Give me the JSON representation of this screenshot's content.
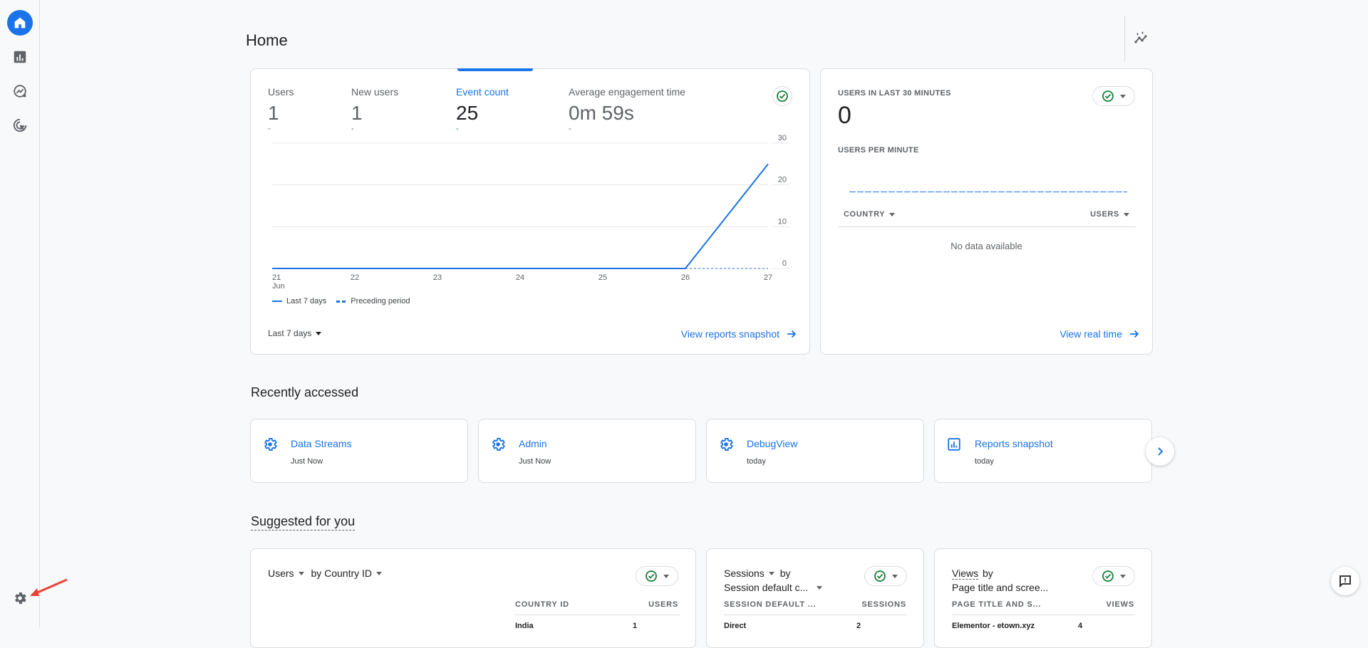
{
  "sidebar": {
    "items": [
      {
        "name": "home",
        "icon": "home-icon",
        "active": true
      },
      {
        "name": "reports",
        "icon": "bar-chart-icon",
        "active": false
      },
      {
        "name": "explore",
        "icon": "explore-icon",
        "active": false
      },
      {
        "name": "advertising",
        "icon": "target-cursor-icon",
        "active": false
      }
    ],
    "settings_icon": "gear-icon"
  },
  "header": {
    "title": "Home",
    "insights_icon": "insights-sparkle-icon"
  },
  "overview_card": {
    "metrics": [
      {
        "label": "Users",
        "value": "1",
        "change": "-",
        "active": false
      },
      {
        "label": "New users",
        "value": "1",
        "change": "-",
        "active": false
      },
      {
        "label": "Event count",
        "value": "25",
        "change": "-",
        "active": true
      },
      {
        "label": "Average engagement time",
        "value": "0m 59s",
        "change": "-",
        "active": false
      }
    ],
    "date_range": "Last 7 days",
    "link": "View reports snapshot"
  },
  "chart_data": {
    "type": "line",
    "title": "Event count",
    "x": [
      "21",
      "22",
      "23",
      "24",
      "25",
      "26",
      "27"
    ],
    "x_sublabel": "Jun",
    "series": [
      {
        "name": "Last 7 days",
        "values": [
          0,
          0,
          0,
          0,
          0,
          0,
          25
        ],
        "style": "solid"
      },
      {
        "name": "Preceding period",
        "values": [
          null,
          null,
          null,
          null,
          null,
          0,
          0
        ],
        "style": "dashed"
      }
    ],
    "yticks": [
      0,
      10,
      20,
      30
    ],
    "ylim": [
      0,
      30
    ],
    "y_axis_side": "right",
    "grid": true,
    "legend": "bottom-left",
    "colors": {
      "primary": "#1a73e8"
    }
  },
  "realtime_card": {
    "title": "USERS IN LAST 30 MINUTES",
    "value": "0",
    "subtitle": "USERS PER MINUTE",
    "columns": [
      "COUNTRY",
      "USERS"
    ],
    "empty_text": "No data available",
    "link": "View real time"
  },
  "recently_accessed": {
    "title": "Recently accessed",
    "items": [
      {
        "title": "Data Streams",
        "time": "Just Now",
        "icon": "gear-icon"
      },
      {
        "title": "Admin",
        "time": "Just Now",
        "icon": "gear-icon"
      },
      {
        "title": "DebugView",
        "time": "today",
        "icon": "gear-icon"
      },
      {
        "title": "Reports snapshot",
        "time": "today",
        "icon": "bar-chart-icon"
      }
    ]
  },
  "suggested": {
    "title": "Suggested for you",
    "cards": [
      {
        "metric": "Users",
        "by": "by Country ID",
        "col1": "COUNTRY ID",
        "col2": "USERS",
        "row1": "India",
        "row1_val": "1"
      },
      {
        "metric": "Sessions",
        "by_prefix": "by",
        "by": "Session default c...",
        "col1": "SESSION DEFAULT ...",
        "col2": "SESSIONS",
        "row1": "Direct",
        "row1_val": "2"
      },
      {
        "metric": "Views",
        "by_prefix": "by",
        "by": "Page title and scree...",
        "col1": "PAGE TITLE AND S...",
        "col2": "VIEWS",
        "row1": "Elementor - etown.xyz",
        "row1_val": "4"
      }
    ]
  },
  "colors": {
    "accent": "#1a73e8",
    "success": "#188038",
    "annotation_arrow": "#ea4335"
  }
}
